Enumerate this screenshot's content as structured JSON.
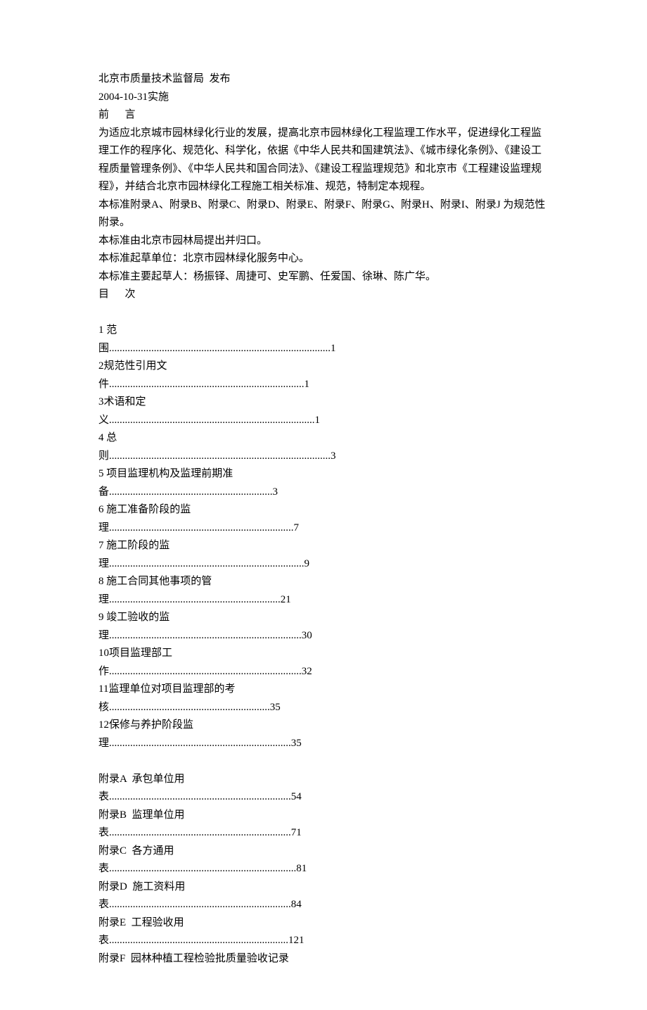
{
  "header": {
    "issuer": "北京市质量技术监督局  发布",
    "impl_date": "2004-10-31实施",
    "preface_title": "前      言",
    "preface_body_1": "为适应北京城市园林绿化行业的发展，提高北京市园林绿化工程监理工作水平，促进绿化工程监理工作的程序化、规范化、科学化，依据《中华人民共和国建筑法》、《城市绿化条例》、《建设工程质量管理条例》、《中华人民共和国合同法》、《建设工程监理规范》和北京市《工程建设监理规程》，并结合北京市园林绿化工程施工相关标准、规范，特制定本规程。",
    "preface_body_2": "本标准附录A、附录B、附录C、附录D、附录E、附录F、附录G、附录H、附录I、附录J 为规范性附录。",
    "preface_body_3": "本标准由北京市园林局提出并归口。",
    "preface_body_4": "本标准起草单位：北京市园林绿化服务中心。",
    "preface_body_5": "本标准主要起草人：杨振铎、周捷可、史军鹏、任爱国、徐琳、陈广华。",
    "contents_title": "目      次"
  },
  "toc": {
    "i1a": "1 范",
    "i1b": "围....................................................................................1",
    "i2a": "2规范性引用文",
    "i2b": "件..........................................................................1",
    "i3a": "3术语和定",
    "i3b": "义..............................................................................1",
    "i4a": "4 总",
    "i4b": "则....................................................................................3",
    "i5a": "5 项目监理机构及监理前期准",
    "i5b": "备..............................................................3",
    "i6a": "6 施工准备阶段的监",
    "i6b": "理......................................................................7",
    "i7a": "7 施工阶段的监",
    "i7b": "理..........................................................................9",
    "i8a": "8 施工合同其他事项的管",
    "i8b": "理.................................................................21",
    "i9a": "9 竣工验收的监",
    "i9b": "理.........................................................................30",
    "i10a": "10项目监理部工",
    "i10b": "作.........................................................................32",
    "i11a": "11监理单位对项目监理部的考",
    "i11b": "核.............................................................35",
    "i12a": "12保修与养护阶段监",
    "i12b": "理.....................................................................35",
    "apAa": "附录A  承包单位用",
    "apAb": "表.....................................................................54",
    "apBa": "附录B  监理单位用",
    "apBb": "表.....................................................................71",
    "apCa": "附录C  各方通用",
    "apCb": "表.......................................................................81",
    "apDa": "附录D  施工资料用",
    "apDb": "表.....................................................................84",
    "apEa": "附录E  工程验收用",
    "apEb": "表....................................................................121",
    "apFa": "附录F  园林种植工程检验批质量验收记录"
  }
}
